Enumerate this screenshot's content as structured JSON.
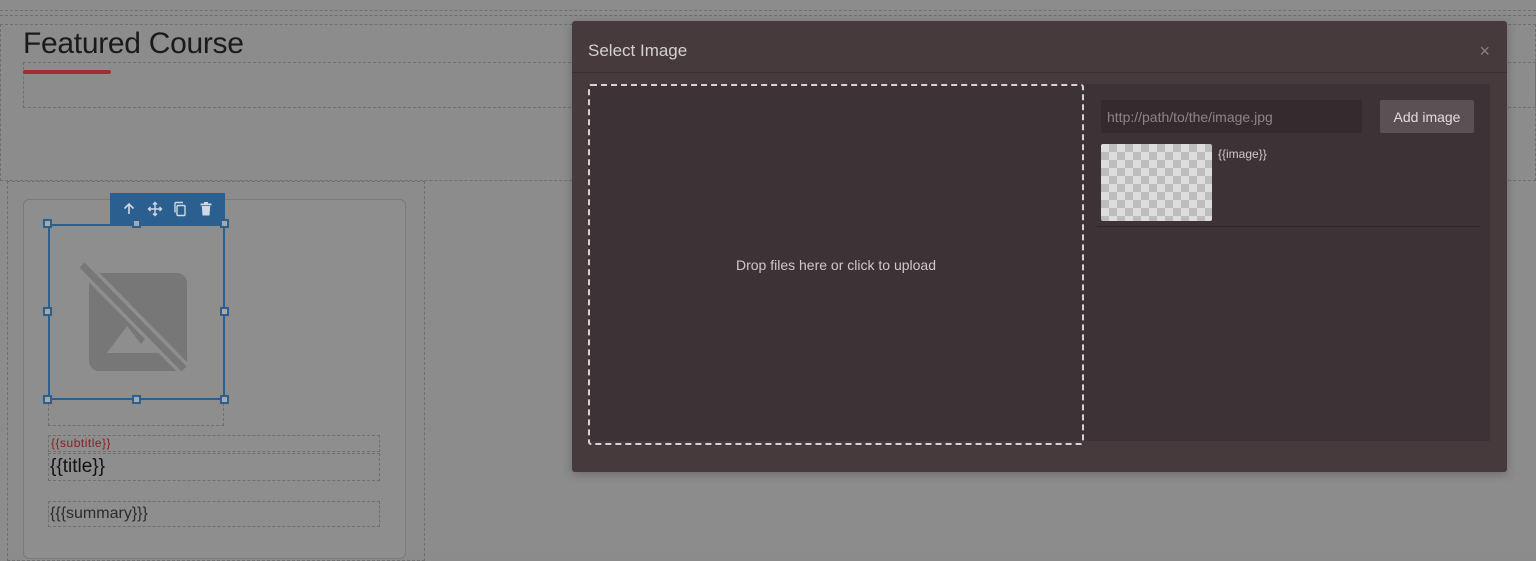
{
  "canvas": {
    "heading": "Featured Course",
    "card": {
      "subtitle": "{{subtitle}}",
      "title": "{{title}}",
      "summary": "{{{summary}}}"
    },
    "toolbar": {
      "icons": [
        "arrow-up-icon",
        "move-icon",
        "copy-icon",
        "trash-icon"
      ]
    }
  },
  "modal": {
    "title": "Select Image",
    "close_label": "×",
    "dropzone_text": "Drop files here or click to upload",
    "url_placeholder": "http://path/to/the/image.jpg",
    "add_button_label": "Add image",
    "assets": [
      {
        "name": "{{image}}"
      }
    ]
  },
  "colors": {
    "overlay_bg": "#8b8b8b",
    "modal_bg": "#463a3d",
    "modal_body_bg": "#3d3337",
    "selection_blue": "#2a5f8f",
    "accent_red": "#9f2f34"
  }
}
